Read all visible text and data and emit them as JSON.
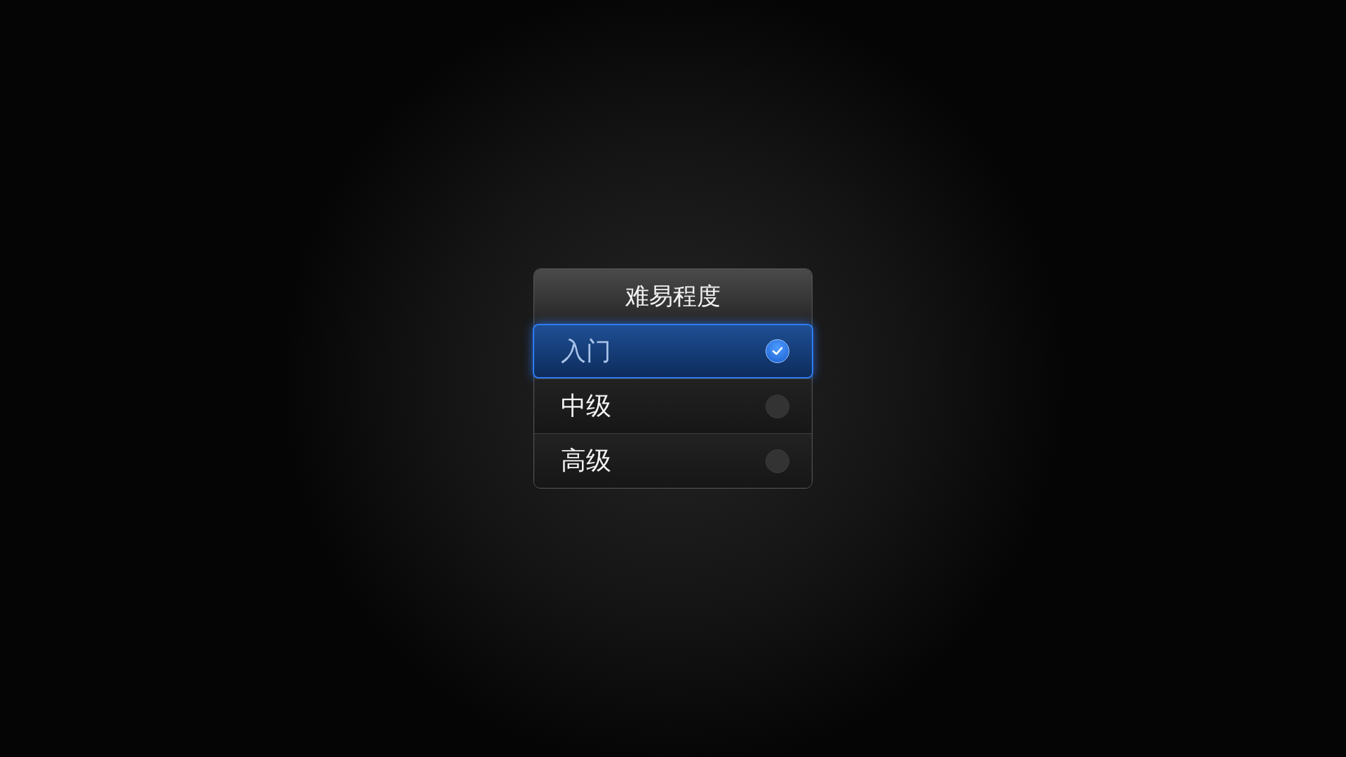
{
  "dialog": {
    "title": "难易程度",
    "options": [
      {
        "label": "入门",
        "selected": true
      },
      {
        "label": "中级",
        "selected": false
      },
      {
        "label": "高级",
        "selected": false
      }
    ]
  }
}
